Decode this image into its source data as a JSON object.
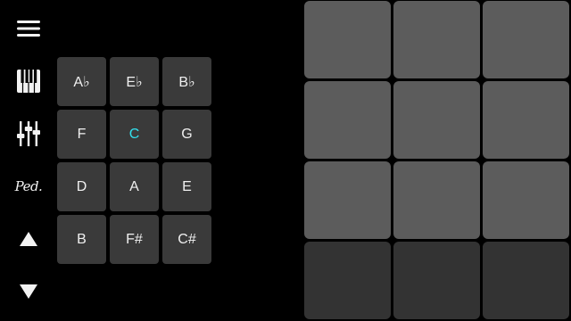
{
  "sidebar": {
    "buttons": [
      {
        "name": "menu-button",
        "icon": "hamburger-menu-icon"
      },
      {
        "name": "piano-button",
        "icon": "piano-keyboard-icon"
      },
      {
        "name": "mixer-button",
        "icon": "mixer-sliders-icon"
      },
      {
        "name": "pedal-button",
        "icon": "sustain-pedal-icon",
        "label": "Ped."
      },
      {
        "name": "octave-up-button",
        "icon": "triangle-up-icon"
      },
      {
        "name": "octave-down-button",
        "icon": "triangle-down-icon"
      }
    ]
  },
  "keys": {
    "rows": [
      [
        "A♭",
        "E♭",
        "B♭"
      ],
      [
        "F",
        "C",
        "G"
      ],
      [
        "D",
        "A",
        "E"
      ],
      [
        "B",
        "F#",
        "C#"
      ]
    ],
    "selected": "C"
  },
  "pads": {
    "rows": [
      [
        "lit",
        "lit",
        "lit"
      ],
      [
        "lit",
        "lit",
        "lit"
      ],
      [
        "lit",
        "lit",
        "lit"
      ],
      [
        "dim",
        "dim",
        "dim"
      ]
    ]
  },
  "colors": {
    "background": "#000000",
    "key_bg": "#3a3a3a",
    "key_text": "#f0f0f0",
    "key_active_text": "#33e0ee",
    "pad_lit": "#5c5c5c",
    "pad_dim": "#333333",
    "icon": "#f2f2f2"
  }
}
